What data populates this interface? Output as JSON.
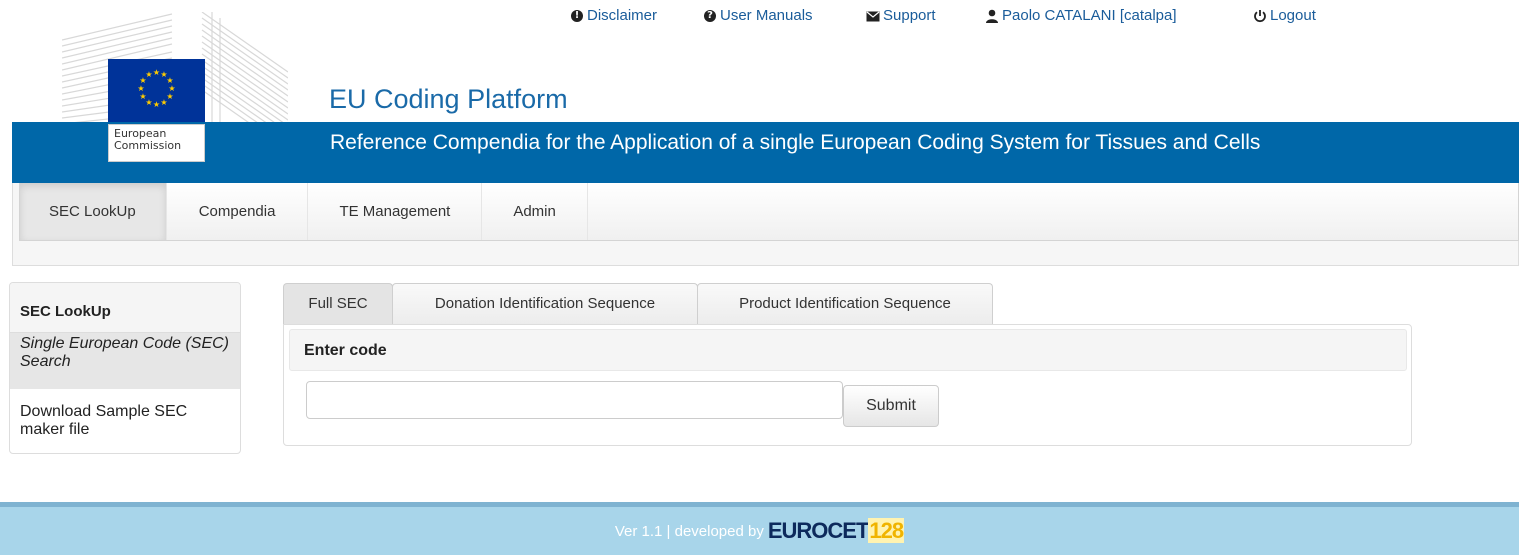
{
  "header": {
    "links": [
      {
        "label": "Disclaimer",
        "icon": "exclamation-circle-icon"
      },
      {
        "label": "User Manuals",
        "icon": "question-circle-icon"
      },
      {
        "label": "Support",
        "icon": "envelope-icon"
      },
      {
        "label": "Paolo CATALANI [catalpa]",
        "icon": "user-icon"
      },
      {
        "label": "Logout",
        "icon": "power-icon"
      }
    ],
    "logo_text_line1": "European",
    "logo_text_line2": "Commission",
    "title": "EU Coding Platform",
    "subtitle": "Reference Compendia for the Application of a single European Coding System for Tissues and Cells"
  },
  "nav": {
    "items": [
      {
        "label": "SEC LookUp",
        "active": true
      },
      {
        "label": "Compendia",
        "active": false
      },
      {
        "label": "TE Management",
        "active": false
      },
      {
        "label": "Admin",
        "active": false
      }
    ]
  },
  "side": {
    "heading": "SEC LookUp",
    "items": [
      {
        "label": "Single European Code (SEC) Search",
        "active": true
      },
      {
        "label": "Download Sample SEC maker file",
        "active": false
      }
    ]
  },
  "tabs": [
    {
      "label": "Full SEC",
      "active": true
    },
    {
      "label": "Donation Identification Sequence",
      "active": false
    },
    {
      "label": "Product Identification Sequence",
      "active": false
    }
  ],
  "form": {
    "heading": "Enter code",
    "input_value": "",
    "submit_label": "Submit"
  },
  "footer": {
    "text": "Ver 1.1 | developed by",
    "logo_part1": "EUROCET",
    "logo_part2": "128"
  },
  "colors": {
    "brand_blue": "#0067a8",
    "link_blue": "#1a5c9a",
    "footer_bg": "#a8d5ea",
    "eu_flag": "#003399",
    "eu_stars": "#ffcc00"
  }
}
